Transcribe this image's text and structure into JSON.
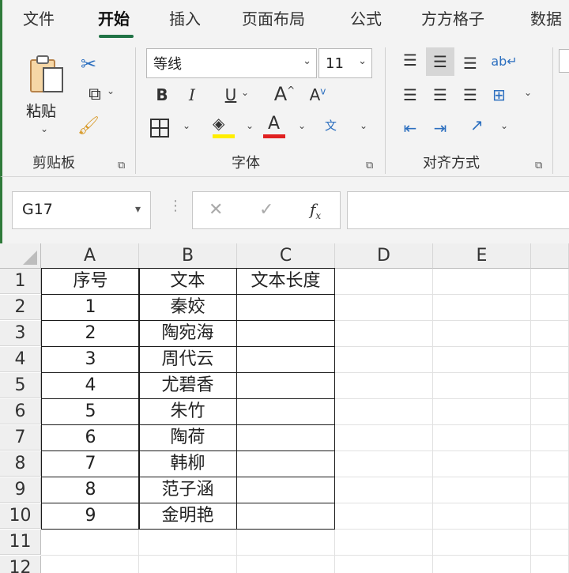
{
  "ribbon_tabs": [
    "文件",
    "开始",
    "插入",
    "页面布局",
    "公式",
    "方方格子",
    "数据"
  ],
  "active_tab": "开始",
  "clipboard": {
    "paste_label": "粘贴",
    "group_label": "剪贴板"
  },
  "font": {
    "name": "等线",
    "size": "11",
    "group_label": "字体"
  },
  "alignment": {
    "group_label": "对齐方式"
  },
  "formula_bar": {
    "name_box": "G17",
    "formula": ""
  },
  "columns": [
    "A",
    "B",
    "C",
    "D",
    "E"
  ],
  "rows": [
    {
      "num": "1",
      "a": "序号",
      "b": "文本",
      "c": "文本长度"
    },
    {
      "num": "2",
      "a": "1",
      "b": "秦姣",
      "c": ""
    },
    {
      "num": "3",
      "a": "2",
      "b": "陶宛海",
      "c": ""
    },
    {
      "num": "4",
      "a": "3",
      "b": "周代云",
      "c": ""
    },
    {
      "num": "5",
      "a": "4",
      "b": "尤碧香",
      "c": ""
    },
    {
      "num": "6",
      "a": "5",
      "b": "朱竹",
      "c": ""
    },
    {
      "num": "7",
      "a": "6",
      "b": "陶荷",
      "c": ""
    },
    {
      "num": "8",
      "a": "7",
      "b": "韩柳",
      "c": ""
    },
    {
      "num": "9",
      "a": "8",
      "b": "范子涵",
      "c": ""
    },
    {
      "num": "10",
      "a": "9",
      "b": "金明艳",
      "c": ""
    },
    {
      "num": "11",
      "a": "",
      "b": "",
      "c": ""
    },
    {
      "num": "12",
      "a": "",
      "b": "",
      "c": ""
    }
  ],
  "colors": {
    "accent": "#217346",
    "font_color": "#e02020",
    "highlight": "#ffee00"
  },
  "icons": [
    "paste-icon",
    "cut-icon",
    "copy-icon",
    "format-painter-icon",
    "bold-icon",
    "italic-icon",
    "underline-icon",
    "borders-icon",
    "fill-color-icon",
    "font-color-icon",
    "phonetic-icon",
    "align-icon",
    "wrap-text-icon",
    "merge-icon",
    "indent-icon",
    "orientation-icon",
    "cancel-icon",
    "enter-icon",
    "fx-icon"
  ]
}
